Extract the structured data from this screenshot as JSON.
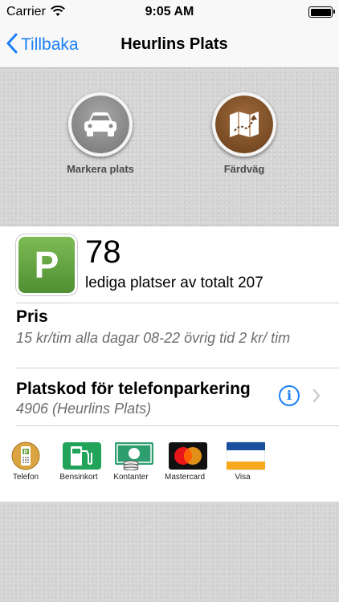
{
  "status_bar": {
    "carrier": "Carrier",
    "time": "9:05 AM"
  },
  "nav": {
    "back_label": "Tillbaka",
    "title": "Heurlins Plats"
  },
  "actions": [
    {
      "label": "Markera plats",
      "icon": "car-icon"
    },
    {
      "label": "Färdväg",
      "icon": "map-icon"
    }
  ],
  "parking": {
    "sign": "P",
    "available": "78",
    "available_label": "lediga platser av totalt 207"
  },
  "price": {
    "title": "Pris",
    "text": "15 kr/tim alla dagar 08-22 övrig tid 2 kr/ tim"
  },
  "phone_code": {
    "title": "Platskod för telefonparkering",
    "text": "4906 (Heurlins Plats)"
  },
  "payment_methods": [
    {
      "label": "Telefon",
      "icon": "phone-payment-icon"
    },
    {
      "label": "Bensinkort",
      "icon": "fuel-card-icon"
    },
    {
      "label": "Kontanter",
      "icon": "cash-icon"
    },
    {
      "label": "Mastercard",
      "icon": "mastercard-icon"
    },
    {
      "label": "Visa",
      "icon": "visa-icon"
    }
  ],
  "colors": {
    "accent": "#1b7ff5",
    "parking_green": "#6da64a"
  }
}
